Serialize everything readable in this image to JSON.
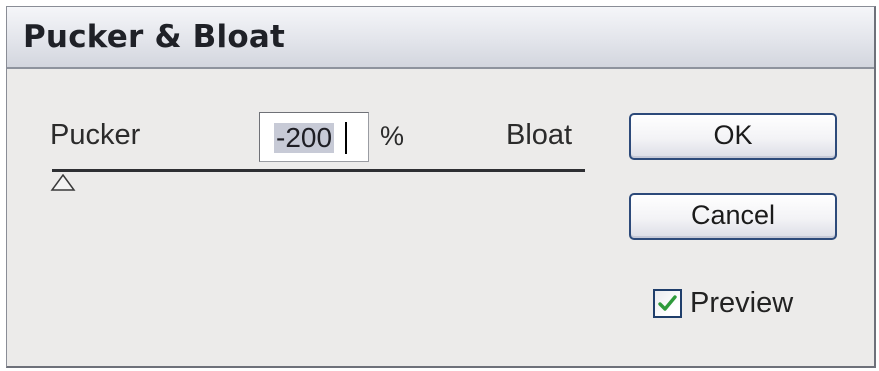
{
  "dialog": {
    "title": "Pucker & Bloat"
  },
  "amount": {
    "left_label": "Pucker",
    "right_label": "Bloat",
    "value": "-200",
    "unit": "%",
    "slider_level_percent": -200,
    "slider_range_percent": [
      -200,
      200
    ]
  },
  "buttons": {
    "ok_label": "OK",
    "cancel_label": "Cancel"
  },
  "preview": {
    "label": "Preview",
    "checked": true,
    "check_color": "#2e9a3a"
  },
  "colors": {
    "dialog_bg": "#ecebea",
    "button_border": "#2d4a7a",
    "selection": "#c7cad6"
  }
}
